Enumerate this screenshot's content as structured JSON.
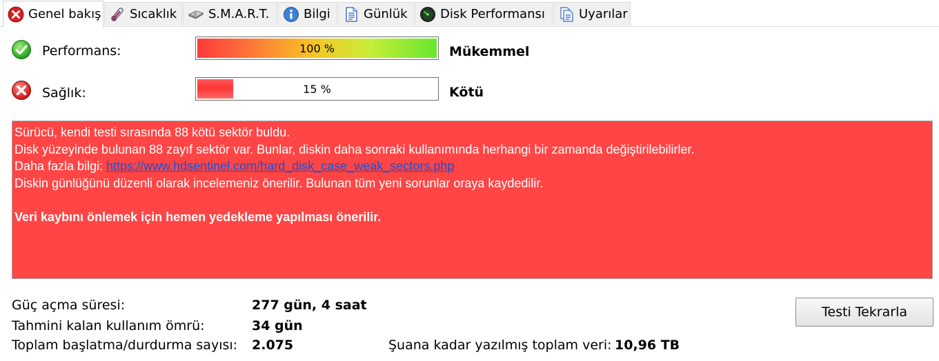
{
  "tabs": [
    {
      "label": "Genel bakış",
      "icon": "error-icon",
      "active": true
    },
    {
      "label": "Sıcaklık",
      "icon": "thermometer-icon"
    },
    {
      "label": "S.M.A.R.T.",
      "icon": "drive-icon"
    },
    {
      "label": "Bilgi",
      "icon": "info-icon"
    },
    {
      "label": "Günlük",
      "icon": "log-icon"
    },
    {
      "label": "Disk Performansı",
      "icon": "gauge-icon"
    },
    {
      "label": "Uyarılar",
      "icon": "alerts-icon"
    }
  ],
  "performance": {
    "label": "Performans:",
    "value": 100,
    "value_text": "100 %",
    "state": "Mükemmel",
    "status_icon": "ok-icon"
  },
  "health": {
    "label": "Sağlık:",
    "value": 15,
    "value_text": "15 %",
    "state": "Kötü",
    "status_icon": "error-icon"
  },
  "message": {
    "line1": "Sürücü, kendi testi sırasında 88 kötü sektör buldu.",
    "line2": "Disk yüzeyinde bulunan 88 zayıf sektör var. Bunlar, diskin daha sonraki kullanımında herhangi bir zamanda değiştirilebilirler.",
    "line3_prefix": "Daha fazla bilgi: ",
    "link": "https://www.hdsentinel.com/hard_disk_case_weak_sectors.php",
    "line4": "Diskin günlüğünü düzenli olarak incelemeniz önerilir. Bulunan tüm yeni sorunlar oraya kaydedilir.",
    "warning": "Veri kaybını önlemek için hemen yedekleme yapılması önerilir.",
    "background_color": "#ff4545"
  },
  "info": {
    "power_on_label": "Güç açma süresi:",
    "power_on_value": "277 gün, 4 saat",
    "remaining_label": "Tahmini kalan kullanım ömrü:",
    "remaining_value": "34 gün",
    "startstop_label": "Toplam başlatma/durdurma sayısı:",
    "startstop_value": "2.075",
    "written_label": "Şuana kadar yazılmış toplam veri:",
    "written_value": "10,96 TB"
  },
  "retest_button": "Testi Tekrarla"
}
